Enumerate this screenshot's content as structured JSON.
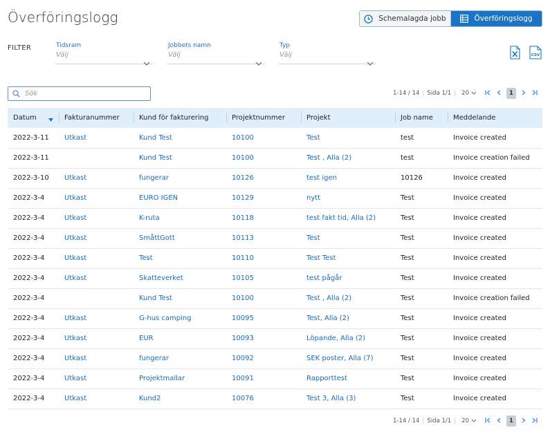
{
  "page": {
    "title": "Överföringslogg"
  },
  "view_toggle": {
    "scheduled_label": "Schemalagda jobb",
    "log_label": "Överföringslogg"
  },
  "filter": {
    "label": "FILTER",
    "fields": [
      {
        "label": "Tidsram",
        "value": "Välj"
      },
      {
        "label": "Jobbets namn",
        "value": "Välj"
      },
      {
        "label": "Typ",
        "value": "Välj"
      }
    ]
  },
  "export": {
    "excel_icon": "excel-icon",
    "csv_icon": "csv-icon",
    "csv_text": "CSV"
  },
  "search": {
    "placeholder": "Sök"
  },
  "pager": {
    "range": "1-14 / 14",
    "page_info": "Sida 1/1",
    "per_page": "20",
    "current_page": "1"
  },
  "table": {
    "columns": [
      "Datum",
      "Fakturanummer",
      "Kund för fakturering",
      "Projektnummer",
      "Projekt",
      "Job name",
      "Meddelande"
    ],
    "rows": [
      {
        "date": "2022-3-11",
        "invoice": "Utkast",
        "customer": "Kund Test",
        "project_no": "10100",
        "project": "Test",
        "job": "test",
        "message": "Invoice created"
      },
      {
        "date": "2022-3-11",
        "invoice": "",
        "customer": "Kund Test",
        "project_no": "10100",
        "project": "Test ,  Alla (2)",
        "job": "test",
        "message": "Invoice creation failed"
      },
      {
        "date": "2022-3-10",
        "invoice": "Utkast",
        "customer": "fungerar",
        "project_no": "10126",
        "project": "test igen",
        "job": "10126",
        "message": "Invoice created"
      },
      {
        "date": "2022-3-4",
        "invoice": "Utkast",
        "customer": "EURO IGEN",
        "project_no": "10129",
        "project": "nytt",
        "job": "Test",
        "message": "Invoice created"
      },
      {
        "date": "2022-3-4",
        "invoice": "Utkast",
        "customer": "K-ruta",
        "project_no": "10118",
        "project": "test fakt tid,  Alla (2)",
        "job": "Test",
        "message": "Invoice created"
      },
      {
        "date": "2022-3-4",
        "invoice": "Utkast",
        "customer": "SmåttGott",
        "project_no": "10113",
        "project": "Test",
        "job": "Test",
        "message": "Invoice created"
      },
      {
        "date": "2022-3-4",
        "invoice": "Utkast",
        "customer": "Test",
        "project_no": "10110",
        "project": "Test Test",
        "job": "Test",
        "message": "Invoice created"
      },
      {
        "date": "2022-3-4",
        "invoice": "Utkast",
        "customer": "Skatteverket",
        "project_no": "10105",
        "project": "test pågår",
        "job": "Test",
        "message": "Invoice created"
      },
      {
        "date": "2022-3-4",
        "invoice": "",
        "customer": "Kund Test",
        "project_no": "10100",
        "project": "Test ,  Alla (2)",
        "job": "Test",
        "message": "Invoice creation failed"
      },
      {
        "date": "2022-3-4",
        "invoice": "Utkast",
        "customer": "G-hus camping",
        "project_no": "10095",
        "project": "Test,  Alla (2)",
        "job": "Test",
        "message": "Invoice created"
      },
      {
        "date": "2022-3-4",
        "invoice": "Utkast",
        "customer": "EUR",
        "project_no": "10093",
        "project": "Löpande,  Alla (2)",
        "job": "Test",
        "message": "Invoice created"
      },
      {
        "date": "2022-3-4",
        "invoice": "Utkast",
        "customer": "fungerar",
        "project_no": "10092",
        "project": "SEK poster,  Alla (7)",
        "job": "Test",
        "message": "Invoice created"
      },
      {
        "date": "2022-3-4",
        "invoice": "Utkast",
        "customer": "Projektmallar",
        "project_no": "10091",
        "project": "Rapporttest",
        "job": "Test",
        "message": "Invoice created"
      },
      {
        "date": "2022-3-4",
        "invoice": "Utkast",
        "customer": "Kund2",
        "project_no": "10076",
        "project": "Test 3,  Alla (3)",
        "job": "Test",
        "message": "Invoice created"
      }
    ]
  },
  "colors": {
    "accent": "#1a73c4",
    "header_bg": "#e1effa",
    "link": "#1a6cb5"
  }
}
